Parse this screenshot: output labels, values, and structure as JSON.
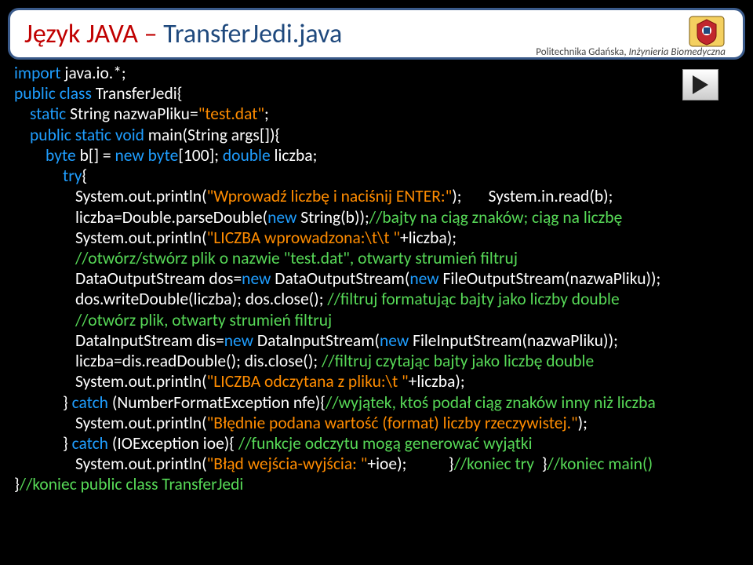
{
  "title": {
    "prefix": "Język JAVA – ",
    "main": "TransferJedi.java"
  },
  "subtitle": {
    "part1": "Politechnika Gdańska, ",
    "part2": "Inżynieria Biomedyczna"
  },
  "logo_name": "university-crest-icon",
  "play_name": "play-icon",
  "code": {
    "l1_a": "import",
    "l1_b": " java.io.*;",
    "l2_a": "public class",
    "l2_b": " TransferJedi{",
    "l3_a": "static",
    "l3_b": " String nazwaPliku=",
    "l3_c": "\"test.dat\"",
    "l3_d": ";",
    "l4_a": "public static void",
    "l4_b": " main(String args[]){",
    "l5_a": "byte",
    "l5_b": " b[] = ",
    "l5_c": "new byte",
    "l5_d": "[100]; ",
    "l5_e": "double",
    "l5_f": " liczba;",
    "l6_a": "try",
    "l6_b": "{",
    "l7_a": "System.out.println(",
    "l7_b": "\"Wprowadź liczbę i naciśnij ENTER:\"",
    "l7_c": ");       System.in.read(b);",
    "l8_a": "liczba=Double.parseDouble(",
    "l8_b": "new",
    "l8_c": " String(b));",
    "l8_d": "//bajty na ciąg znaków; ciąg na liczbę",
    "l9_a": "System.out.println(",
    "l9_b": "\"LICZBA wprowadzona:\\t\\t \"",
    "l9_c": "+liczba);",
    "l10": "//otwórz/stwórz plik o nazwie \"test.dat\", otwarty strumień filtruj",
    "l11_a": "DataOutputStream dos=",
    "l11_b": "new",
    "l11_c": " DataOutputStream(",
    "l11_d": "new",
    "l11_e": " FileOutputStream(nazwaPliku));",
    "l12_a": "dos.writeDouble(liczba); dos.close(); ",
    "l12_b": "//filtruj formatując bajty jako liczby double",
    "l13": "//otwórz plik, otwarty strumień filtruj",
    "l14_a": "DataInputStream dis=",
    "l14_b": "new",
    "l14_c": " DataInputStream(",
    "l14_d": "new",
    "l14_e": " FileInputStream(nazwaPliku));",
    "l15_a": "liczba=dis.readDouble(); dis.close(); ",
    "l15_b": "//filtruj czytając bajty jako liczbę double",
    "l16_a": "System.out.println(",
    "l16_b": "\"LICZBA odczytana z pliku:\\t \"",
    "l16_c": "+liczba);",
    "l17_a": "} ",
    "l17_b": "catch",
    "l17_c": " (NumberFormatException nfe){",
    "l17_d": "//wyjątek, ktoś podał ciąg znaków inny niż liczba",
    "l18_a": "System.out.println(",
    "l18_b": "\"Błędnie podana wartość (format) liczby rzeczywistej.\"",
    "l18_c": ");",
    "l19_a": "} ",
    "l19_b": "catch",
    "l19_c": " (IOException ioe){ ",
    "l19_d": "//funkcje odczytu mogą generować wyjątki",
    "l20_a": "System.out.println(",
    "l20_b": "\"Błąd wejścia-wyjścia: \"",
    "l20_c": "+ioe);           }",
    "l20_d": "//koniec try",
    "l20_e": "  }",
    "l20_f": "//koniec main()",
    "l21_a": "}",
    "l21_b": "//koniec public class TransferJedi"
  }
}
